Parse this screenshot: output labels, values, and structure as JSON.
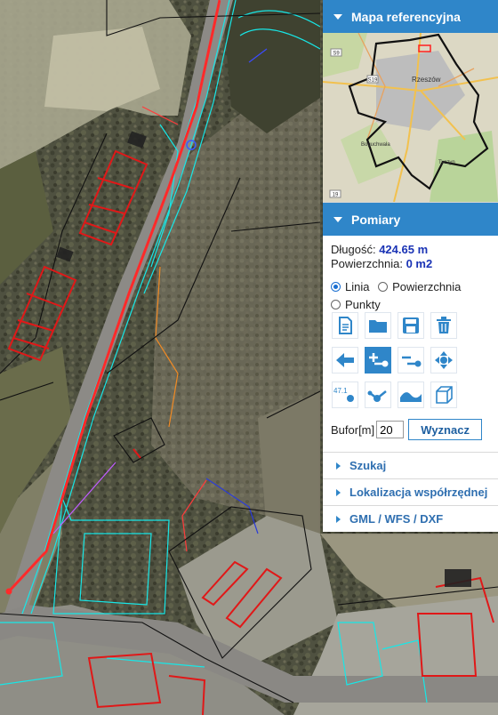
{
  "panel": {
    "refmap_title": "Mapa referencyjna",
    "refmap_city_label": "Rzeszów",
    "refmap_place_1": "Boguchwała",
    "refmap_place_2": "Tyczyn",
    "refmap_road_1": "S9",
    "refmap_road_2": "S19",
    "refmap_road_3": "19",
    "pomiary_title": "Pomiary",
    "length_label": "Długość:",
    "length_value": "424.65 m",
    "area_label": "Powierzchnia:",
    "area_value": "0 m2",
    "mode_options": [
      "Linia",
      "Powierzchnia",
      "Punkty"
    ],
    "mode_selected": "Linia",
    "tool_icons": [
      "new-document-icon",
      "open-folder-icon",
      "save-icon",
      "trash-icon",
      "back-arrow-icon",
      "add-vertex-icon",
      "remove-vertex-icon",
      "pan-arrows-icon",
      "label-value-icon",
      "polyline-icon",
      "profile-curve-icon",
      "3d-box-icon"
    ],
    "tool_active": "add-vertex-icon",
    "label_icon_text": "47.1",
    "buffer_label": "Bufor[m]",
    "buffer_value": "20",
    "compute_button": "Wyznacz",
    "sections": [
      "Szukaj",
      "Lokalizacja współrzędnej",
      "GML / WFS / DXF"
    ]
  },
  "colors": {
    "panel_header": "#2f86c9",
    "link": "#2f6fb0",
    "measure_line": "#ff3030"
  }
}
